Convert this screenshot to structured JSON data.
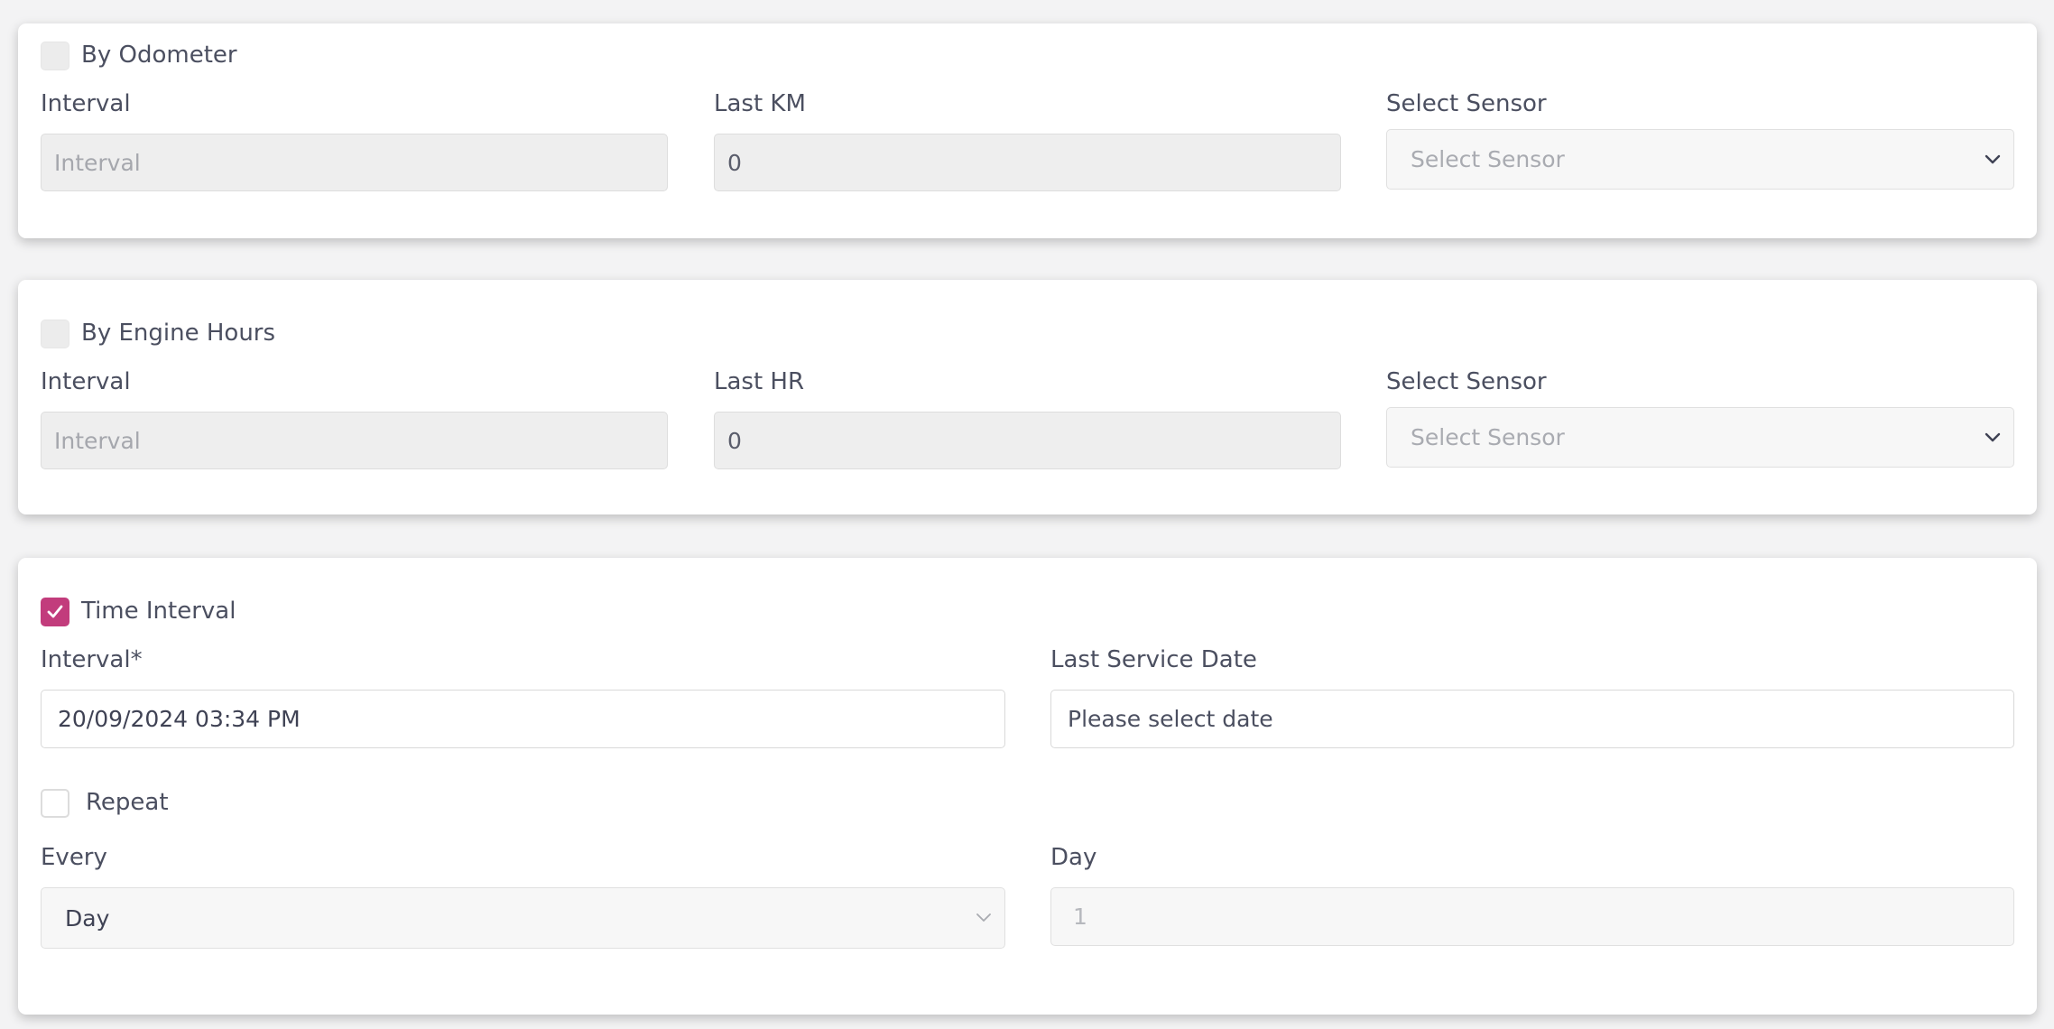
{
  "odometer": {
    "checkbox_label": "By Odometer",
    "checked": false,
    "interval_label": "Interval",
    "interval_placeholder": "Interval",
    "last_label": "Last KM",
    "last_value": "0",
    "sensor_label": "Select Sensor",
    "sensor_placeholder": "Select Sensor"
  },
  "engine_hours": {
    "checkbox_label": "By Engine Hours",
    "checked": false,
    "interval_label": "Interval",
    "interval_placeholder": "Interval",
    "last_label": "Last HR",
    "last_value": "0",
    "sensor_label": "Select Sensor",
    "sensor_placeholder": "Select Sensor"
  },
  "time_interval": {
    "checkbox_label": "Time Interval",
    "checked": true,
    "interval_label": "Interval*",
    "interval_value": "20/09/2024 03:34 PM",
    "last_service_label": "Last Service Date",
    "last_service_placeholder": "Please select date",
    "repeat_label": "Repeat",
    "repeat_checked": false,
    "every_label": "Every",
    "every_value": "Day",
    "day_label": "Day",
    "day_value": "1"
  },
  "colors": {
    "accent": "#c23c7c",
    "background": "#f3f3f4",
    "card": "#ffffff",
    "disabled_input": "#eeeeee"
  }
}
